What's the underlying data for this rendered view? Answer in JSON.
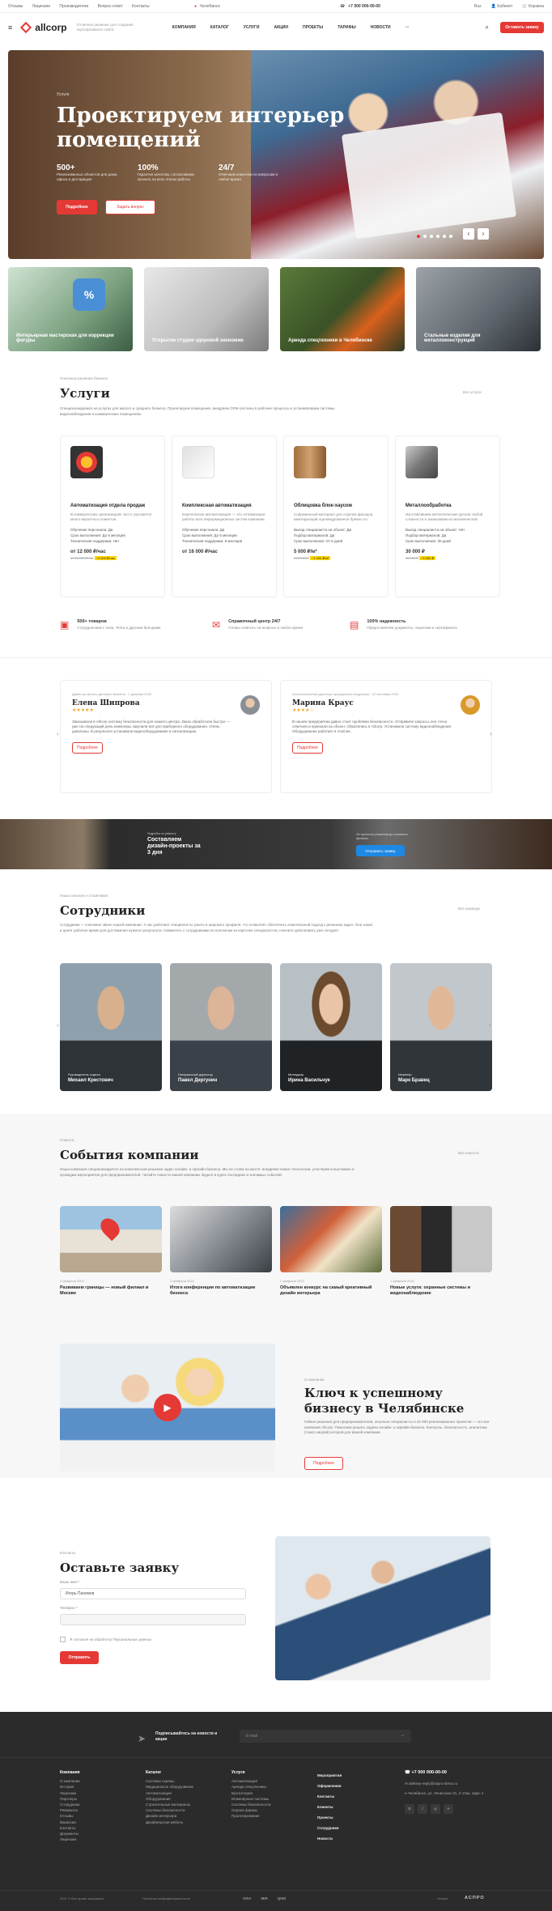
{
  "topbar": {
    "links": [
      "Отзывы",
      "Лицензии",
      "Производители",
      "Вопрос-ответ",
      "Контакты"
    ],
    "city": "Челябинск",
    "phone": "+7 000 000-00-00",
    "lang": "Rus",
    "cabinet": "Кабинет",
    "cart": "Корзина"
  },
  "header": {
    "logo": "allcorp",
    "tagline": "Отличное решение для создания корпоративного сайта",
    "nav": [
      "КОМПАНИЯ",
      "КАТАЛОГ",
      "УСЛУГИ",
      "АКЦИИ",
      "ПРОЕКТЫ",
      "ТАРИФЫ",
      "НОВОСТИ"
    ],
    "more": "···",
    "cta": "Оставить заявку"
  },
  "hero": {
    "kicker": "Услуги",
    "title": "Проектируем интерьер помещений",
    "stats": [
      {
        "value": "500+",
        "text": "Реализованных объектов для дома, офиса и дестарации"
      },
      {
        "value": "100%",
        "text": "Гарантия качества, согласование проекта на всех этапах работы"
      },
      {
        "value": "24/7",
        "text": "Отвечаем клиентам по вопросам в любое время"
      }
    ],
    "btn1": "Подробнее",
    "btn2": "Задать вопрос"
  },
  "promo_cards": [
    "Интерьерная мастерская для коррекции фигуры",
    "Открытие студии здоровой экономии",
    "Аренда спецтехники в Челябинске",
    "Стальные изделия для металлоконструкций"
  ],
  "services": {
    "sub": "Полезные решения бизнеса",
    "title": "Услуги",
    "all": "Все услуги",
    "desc": "Специализируемся на услугах для малого и среднего бизнеса. Проектируем помещения, внедряем CRM-системы в рабочие процессы и устанавливаем системы видеонаблюдения в коммерческих помещениях.",
    "items": [
      {
        "title": "Автоматизация отдела продаж",
        "desc": "В коммерческих организациях часто упускается много вероятных клиентов.",
        "list": [
          "Обучение персонала: Да",
          "Срок выполнения: До 6 месяцев",
          "Техническая поддержка: Нет"
        ],
        "price": "от 12 000 ₽/час",
        "old": "от 14 000 ₽/час",
        "badge": "−2 000 ₽/час"
      },
      {
        "title": "Комплексная автоматизация",
        "desc": "Комплексная автоматизация — это оптимизация работы всех информационных систем компании.",
        "list": [
          "Обучение персонала: Да",
          "Срок выполнения: До 6 месяцев",
          "Техническая поддержка: 6 месяцев"
        ],
        "price": "от 16 000 ₽/час",
        "old": "",
        "badge": ""
      },
      {
        "title": "Облицовка блок-хаусом",
        "desc": "Современный материал для отделки фасадов, имитирующий оцилиндрованное бревно по.",
        "list": [
          "Выезд специалиста на объект: Да",
          "Подбор материалов: Да",
          "Срок выполнения: От 5 дней"
        ],
        "price": "5 000 ₽/м²",
        "old": "6 000 ₽/м²",
        "badge": "−1 000 ₽/м²"
      },
      {
        "title": "Металлообработка",
        "desc": "Изготавливаем металлические детали любой сложности и заказываем их механической.",
        "list": [
          "Выезд специалиста на объект: Нет",
          "Подбор материалов: Да",
          "Срок выполнения: 30 дней"
        ],
        "price": "30 000 ₽",
        "old": "35 000 ₽",
        "badge": "−5 000 ₽"
      }
    ]
  },
  "features": [
    {
      "title": "500+ товаров",
      "text": "Сотрудничаем с Vasa, Tertra и другими брендами"
    },
    {
      "title": "Справочный центр 24/7",
      "text": "Готовы ответить на вопросы в любое время"
    },
    {
      "title": "100% надежность",
      "text": "Предоставляем документы, лицензии и сертификаты"
    }
  ],
  "reviews": [
    {
      "meta": "Директор малого делового бизнеса · 1 декабря 2020",
      "name": "Елена Шипрова",
      "text": "Заказывала в Allcorp систему безопасности для нашего центра. Заказ обработали быстро — уже на следующий день инженеры закупили всё для приборного оборудования. Очень довольны. В результате установили видеооборудование и сигнализацию.",
      "btn": "Подробнее"
    },
    {
      "meta": "Исполнительный директор предприятия индустрии · 22 сентября 2020",
      "name": "Марина Краус",
      "text": "В нашем предприятии давно стоит проблема безопасности. Отправили запросы, все точно ответили и приехали на объект. Обратились в Allcorp. Установили систему видеонаблюдения. Оборудование работает в этой же.",
      "btn": "Подробнее"
    }
  ],
  "banner": {
    "text": "Составляем дизайн-проекты за 3 дня",
    "sub": "Подробно по ремонту",
    "right": "От простого решения до сложного проекта",
    "btn": "Отправить заявку"
  },
  "team": {
    "sub": "Наша сильная и отзывчивая",
    "title": "Сотрудники",
    "all": "Все команда",
    "desc": "Сотрудники — ключевое звено нашей компании. У нас работают специалисты узкого и широкого профиля, что позволяет обеспечить комплексный подход к решению задач. Они знают и ценят рабочее время для достижения нужного результата. Свяжитесь с сотрудниками по контактам из карточек специалистов. Начните действовать уже сегодня!",
    "people": [
      {
        "name": "Михаил Крестович",
        "pos": "Руководитель отдела"
      },
      {
        "name": "Павел Дергунин",
        "pos": "Генеральный директор"
      },
      {
        "name": "Ирина Васильчук",
        "pos": "Менеджер"
      },
      {
        "name": "Марк Бравец",
        "pos": "Инженер"
      }
    ]
  },
  "news": {
    "sub": "Новости",
    "title": "События компании",
    "all": "Все новости",
    "desc": "Наша компания специализируется на комплексном решении задач онлайн- и офлайн-бизнеса. Мы не стоим на месте: внедряем новые технологии, участвуем в выставках и проводим мероприятия для предпринимателей. Читайте новости нашей компании. Будьте в курсе последних и значимых событий.",
    "items": [
      {
        "date": "4 февраля 2021",
        "title": "Развиваем границы — новый филиал в Москве"
      },
      {
        "date": "2 февраля 2021",
        "title": "Итоги конференции по автоматизации бизнеса"
      },
      {
        "date": "1 февраля 2021",
        "title": "Объявлен конкурс на самый креативный дизайн интерьера"
      },
      {
        "date": "1 февраля 2021",
        "title": "Новые услуги: охранные системы и видеонаблюдение"
      }
    ]
  },
  "about": {
    "sub": "О компании",
    "title": "Ключ к успешному бизнесу в Челябинске",
    "text": "Гибкие решения для предпринимателей, опытные специалисты и 20 000 реализованных проектов — это все компания Allcorp. Помогаем решать задачи онлайн- и офлайн-бизнеса. Контроль, безопасность, аналитика (тоже) наш(ий) которой для вашей компании.",
    "btn": "Подробнее"
  },
  "form": {
    "sub": "Контакты",
    "title": "Оставьте заявку",
    "name_label": "Ваше имя *",
    "name_value": "Игорь Пахомов",
    "phone_label": "Телефон *",
    "phone_value": "",
    "consent": "Я согласен на обработку Персональных данных",
    "submit": "Отправить"
  },
  "footer": {
    "subscribe": "Подписывайтесь на новости и акции",
    "email_ph": "E-mail",
    "cols": [
      {
        "title": "Компания",
        "items": [
          "О компании",
          "История",
          "Лицензии",
          "Партнеры",
          "Сотрудники",
          "Реквизиты",
          "Отзывы",
          "Вакансии",
          "Контакты",
          "Документы",
          "Лицензии"
        ]
      },
      {
        "title": "Каталог",
        "items": [
          "Системы охраны",
          "Медицинское оборудование",
          "Автоматизация",
          "Оборудование",
          "Строительные материалы",
          "Системы безопасности",
          "Дизайн интерьера",
          "Дизайнерская мебель"
        ]
      },
      {
        "title": "Услуги",
        "items": [
          "Автоматизация",
          "Аренда спецтехники",
          "Бухгалтерия",
          "Инженерные системы",
          "Системы безопасности",
          "Охрана фирмы",
          "Проектирование"
        ]
      },
      {
        "title": "",
        "items": [
          "Мероприятия",
          "Оформления",
          "Контакты",
          "Клиенты",
          "Проекты",
          "Сотрудники",
          "Новости"
        ]
      }
    ],
    "phone": "+7 000 000-00-00",
    "email": "aleksey-reply@aspro-demo.ru",
    "address": "Челябинск, ул. Ленинская 31, 3 этаж, офис 4",
    "copyright": "2021 © Все права защищены",
    "policy": "Политика конфиденциальности",
    "payments": [
      "VISA",
      "MIR",
      "QIWI"
    ],
    "version": "Version",
    "brand": "АСПРО"
  },
  "colors": {
    "accent": "#e53935",
    "dark": "#2b2b2b"
  }
}
